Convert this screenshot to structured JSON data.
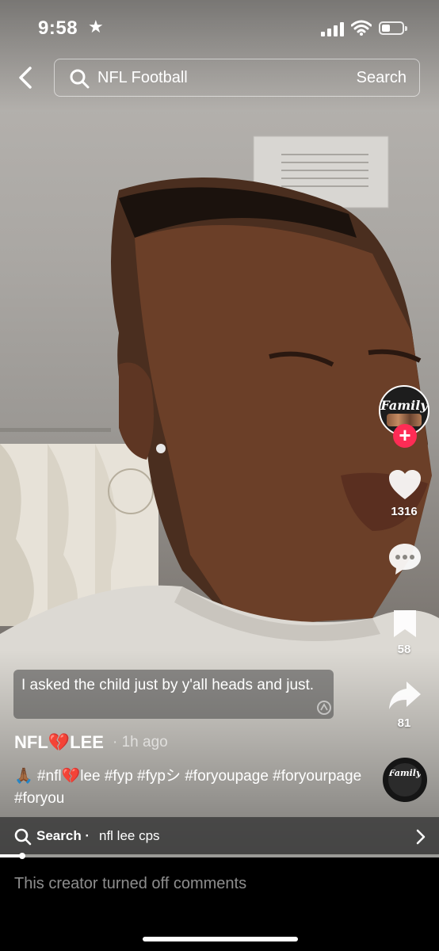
{
  "status_bar": {
    "time": "9:58",
    "star": "★"
  },
  "header": {
    "query": "NFL Football",
    "search_button": "Search"
  },
  "actions": {
    "likes": "1316",
    "saves": "58",
    "shares": "81",
    "avatar_text": "Family",
    "follow": "+"
  },
  "video": {
    "progress": 0.05
  },
  "caption": "I asked the child just by y'all heads and just.",
  "author": {
    "username": "NFL💔LEE",
    "time_ago": "· 1h ago"
  },
  "description": "🙏🏾 #nfl💔lee #fyp #fypシ #foryoupage #foryourpage #foryou",
  "search_suggestion": {
    "label": "Search ·",
    "term": "nfl lee cps"
  },
  "footer": {
    "comments_off": "This creator turned off comments"
  },
  "colors": {
    "accent": "#fe2c55"
  }
}
